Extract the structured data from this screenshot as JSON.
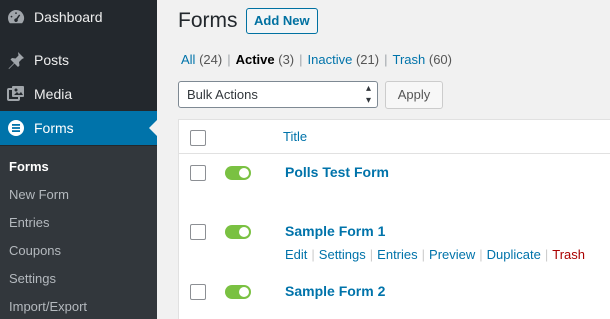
{
  "sidebar": {
    "menu": [
      {
        "label": "Dashboard",
        "icon": "dashboard-icon"
      },
      {
        "label": "Posts",
        "icon": "pin-icon"
      },
      {
        "label": "Media",
        "icon": "media-icon"
      },
      {
        "label": "Forms",
        "icon": "forms-icon",
        "active": true
      }
    ],
    "submenu": [
      "Forms",
      "New Form",
      "Entries",
      "Coupons",
      "Settings",
      "Import/Export"
    ]
  },
  "header": {
    "title": "Forms",
    "add_new_label": "Add New"
  },
  "filters": [
    {
      "label": "All",
      "count": "(24)",
      "current": false
    },
    {
      "label": "Active",
      "count": "(3)",
      "current": true
    },
    {
      "label": "Inactive",
      "count": "(21)",
      "current": false
    },
    {
      "label": "Trash",
      "count": "(60)",
      "current": false
    }
  ],
  "bulk_actions": {
    "selected": "Bulk Actions",
    "apply_label": "Apply"
  },
  "table": {
    "column_title": "Title",
    "rows": [
      {
        "name": "Polls Test Form",
        "active": true
      },
      {
        "name": "Sample Form 1",
        "active": true
      },
      {
        "name": "Sample Form 2",
        "active": true
      }
    ],
    "row_actions": [
      "Edit",
      "Settings",
      "Entries",
      "Preview",
      "Duplicate",
      "Trash"
    ]
  },
  "colors": {
    "accent": "#0073aa",
    "sidebar": "#23282d",
    "toggle_on": "#7ac142",
    "trash": "#aa0000"
  }
}
